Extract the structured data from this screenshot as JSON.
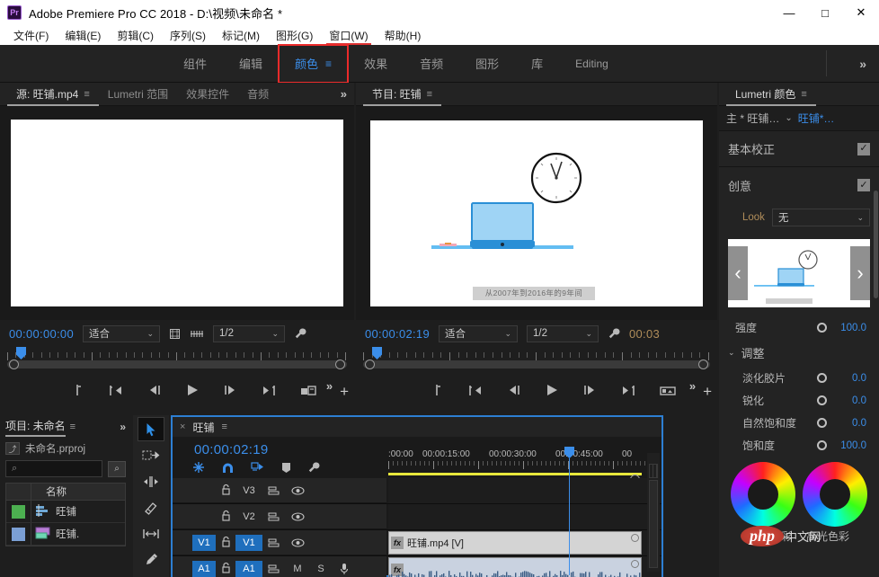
{
  "window": {
    "app_badge": "Pr",
    "title": "Adobe Premiere Pro CC 2018 - D:\\视频\\未命名 *",
    "minimize": "—",
    "maximize": "□",
    "close": "✕"
  },
  "menubar": {
    "items": [
      {
        "label": "文件(F)"
      },
      {
        "label": "编辑(E)"
      },
      {
        "label": "剪辑(C)"
      },
      {
        "label": "序列(S)"
      },
      {
        "label": "标记(M)"
      },
      {
        "label": "图形(G)"
      },
      {
        "label": "窗口(W)"
      },
      {
        "label": "帮助(H)"
      }
    ]
  },
  "workspace": {
    "tabs": [
      {
        "label": "组件"
      },
      {
        "label": "编辑"
      },
      {
        "label": "颜色"
      },
      {
        "label": "效果"
      },
      {
        "label": "音频"
      },
      {
        "label": "图形"
      },
      {
        "label": "库"
      },
      {
        "label": "Editing"
      }
    ],
    "active": "颜色",
    "burger": "≡",
    "overflow": "»",
    "highlight_color": "#ec2b2b",
    "accent_color": "#3b8eea"
  },
  "source_monitor": {
    "tabs": [
      {
        "label": "源: 旺铺.mp4",
        "burger": "≡"
      },
      {
        "label": "Lumetri 范围"
      },
      {
        "label": "效果控件"
      },
      {
        "label": "音频"
      }
    ],
    "overflow": "»",
    "timecode": "00:00:00:00",
    "fit": "适合",
    "resolution": "1/2",
    "controls": {
      "export_frame": "▤",
      "settings": "🔧",
      "markers": "⇢"
    }
  },
  "program_monitor": {
    "tab": "节目: 旺铺",
    "burger": "≡",
    "timecode": "00:00:02:19",
    "fit": "适合",
    "resolution": "1/2",
    "duration": "00:03",
    "video_subtitle": "从2007年到2016年的9年间"
  },
  "lumetri": {
    "tab": "Lumetri 颜色",
    "burger": "≡",
    "master": "主 * 旺铺…",
    "chevron": "⌄",
    "clip": "旺铺*…",
    "sections": [
      {
        "name": "基本校正",
        "enabled": true,
        "check": "✓"
      },
      {
        "name": "创意",
        "enabled": true,
        "check": "✓"
      }
    ],
    "look_label": "Look",
    "look_value": "无",
    "look_prev": "‹",
    "look_next": "›",
    "look_thumb_caption": "从2007年到2016年的9年间",
    "intensity": {
      "label": "强度",
      "value": "100.0"
    },
    "adjust_group": {
      "label": "调整",
      "tri": "⌄"
    },
    "adjust_sliders": [
      {
        "label": "淡化胶片",
        "value": "0.0"
      },
      {
        "label": "锐化",
        "value": "0.0"
      },
      {
        "label": "自然饱和度",
        "value": "0.0"
      },
      {
        "label": "饱和度",
        "value": "100.0"
      }
    ],
    "wheels": [
      {
        "label": "阴影色彩"
      },
      {
        "label": "高光色彩"
      }
    ],
    "watermark": {
      "php": "php",
      "cn": "中文网"
    }
  },
  "project": {
    "title": "项目: 未命名",
    "burger": "≡",
    "overflow": "»",
    "file_name": "未命名.prproj",
    "search_placeholder": "",
    "search_icon": "⌕",
    "filter_icon": "⌕",
    "columns": [
      "",
      "名称"
    ],
    "rows": [
      {
        "swatch": "#4caf50",
        "name": "旺铺",
        "type": "sequence"
      },
      {
        "swatch": "#7b9fd4",
        "name": "旺铺.",
        "type": "video"
      }
    ]
  },
  "tools": {
    "items": [
      {
        "name": "selection-tool",
        "active": true
      },
      {
        "name": "track-select-forward-tool",
        "active": false
      },
      {
        "name": "ripple-edit-tool",
        "active": false
      },
      {
        "name": "razor-tool",
        "active": false
      },
      {
        "name": "slip-tool",
        "active": false
      },
      {
        "name": "pen-tool",
        "active": false
      }
    ]
  },
  "timeline": {
    "close": "×",
    "name": "旺铺",
    "burger": "≡",
    "timecode": "00:00:02:19",
    "tool_icons": [
      "snap-in-timeline",
      "magnet",
      "linked-selection",
      "add-marker",
      "timeline-settings"
    ],
    "ruler_labels": [
      ":00:00",
      "00:00:15:00",
      "00:00:30:00",
      "00:00:45:00",
      "00"
    ],
    "tracks": [
      {
        "id": "V3",
        "source_badge": "",
        "source_on": false,
        "target_on": false,
        "type": "video"
      },
      {
        "id": "V2",
        "source_badge": "",
        "source_on": false,
        "target_on": false,
        "type": "video"
      },
      {
        "id": "V1",
        "source_badge": "V1",
        "source_on": true,
        "target_on": true,
        "type": "video"
      },
      {
        "id": "A1",
        "source_badge": "A1",
        "source_on": true,
        "target_on": true,
        "type": "audio",
        "mute": "M",
        "solo": "S"
      }
    ],
    "clips": [
      {
        "track": "V1",
        "label": "旺铺.mp4 [V]",
        "fx": "fx"
      },
      {
        "track": "A1",
        "label": "",
        "fx": "fx"
      }
    ]
  }
}
